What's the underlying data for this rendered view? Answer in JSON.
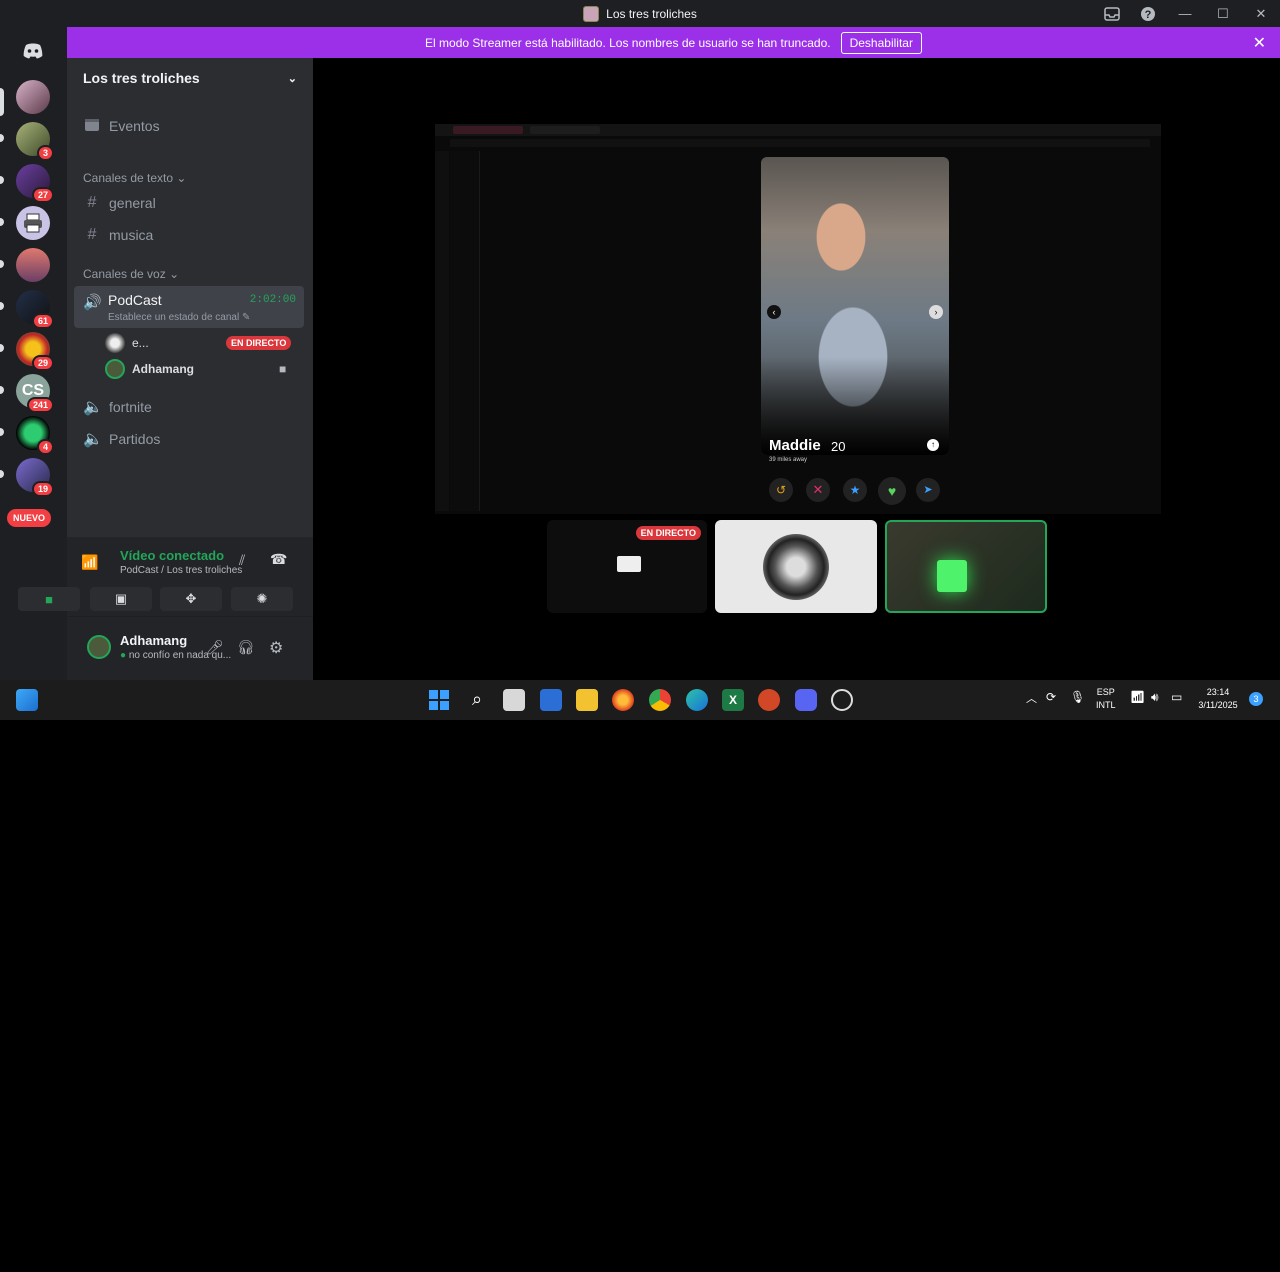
{
  "window": {
    "title": "Los tres troliches"
  },
  "banner": {
    "text": "El modo Streamer está habilitado. Los nombres de usuario se han truncado.",
    "button": "Deshabilitar"
  },
  "servers": {
    "badges": [
      "3",
      "27",
      "61",
      "29",
      "241",
      "4",
      "19"
    ],
    "new_label": "NUEVO"
  },
  "guild": {
    "name": "Los tres troliches"
  },
  "sidebar": {
    "events": "Eventos",
    "text_category": "Canales de texto",
    "text_channels": [
      "general",
      "musica"
    ],
    "voice_category": "Canales de voz",
    "active_voice": {
      "name": "PodCast",
      "time": "2:02:00",
      "status": "Establece un estado de canal"
    },
    "members": [
      {
        "name": "e...",
        "badge": "EN DIRECTO"
      },
      {
        "name": "Adhamang"
      }
    ],
    "other_voice": [
      "fortnite",
      "Partidos"
    ]
  },
  "voice_panel": {
    "status": "Vídeo conectado",
    "location": "PodCast / Los tres troliches"
  },
  "user_panel": {
    "name": "Adhamang",
    "status": "no confío en nada qu..."
  },
  "stream": {
    "profile_name": "Maddie",
    "profile_age": "20",
    "distance": "39 miles away"
  },
  "tiles": {
    "live_label": "EN DIRECTO"
  },
  "taskbar": {
    "lang1": "ESP",
    "lang2": "INTL",
    "time": "23:14",
    "date": "3/11/2025",
    "notif": "3"
  },
  "colors": {
    "accent": "#9b30e8",
    "online": "#23a55a",
    "live": "#da373c"
  }
}
